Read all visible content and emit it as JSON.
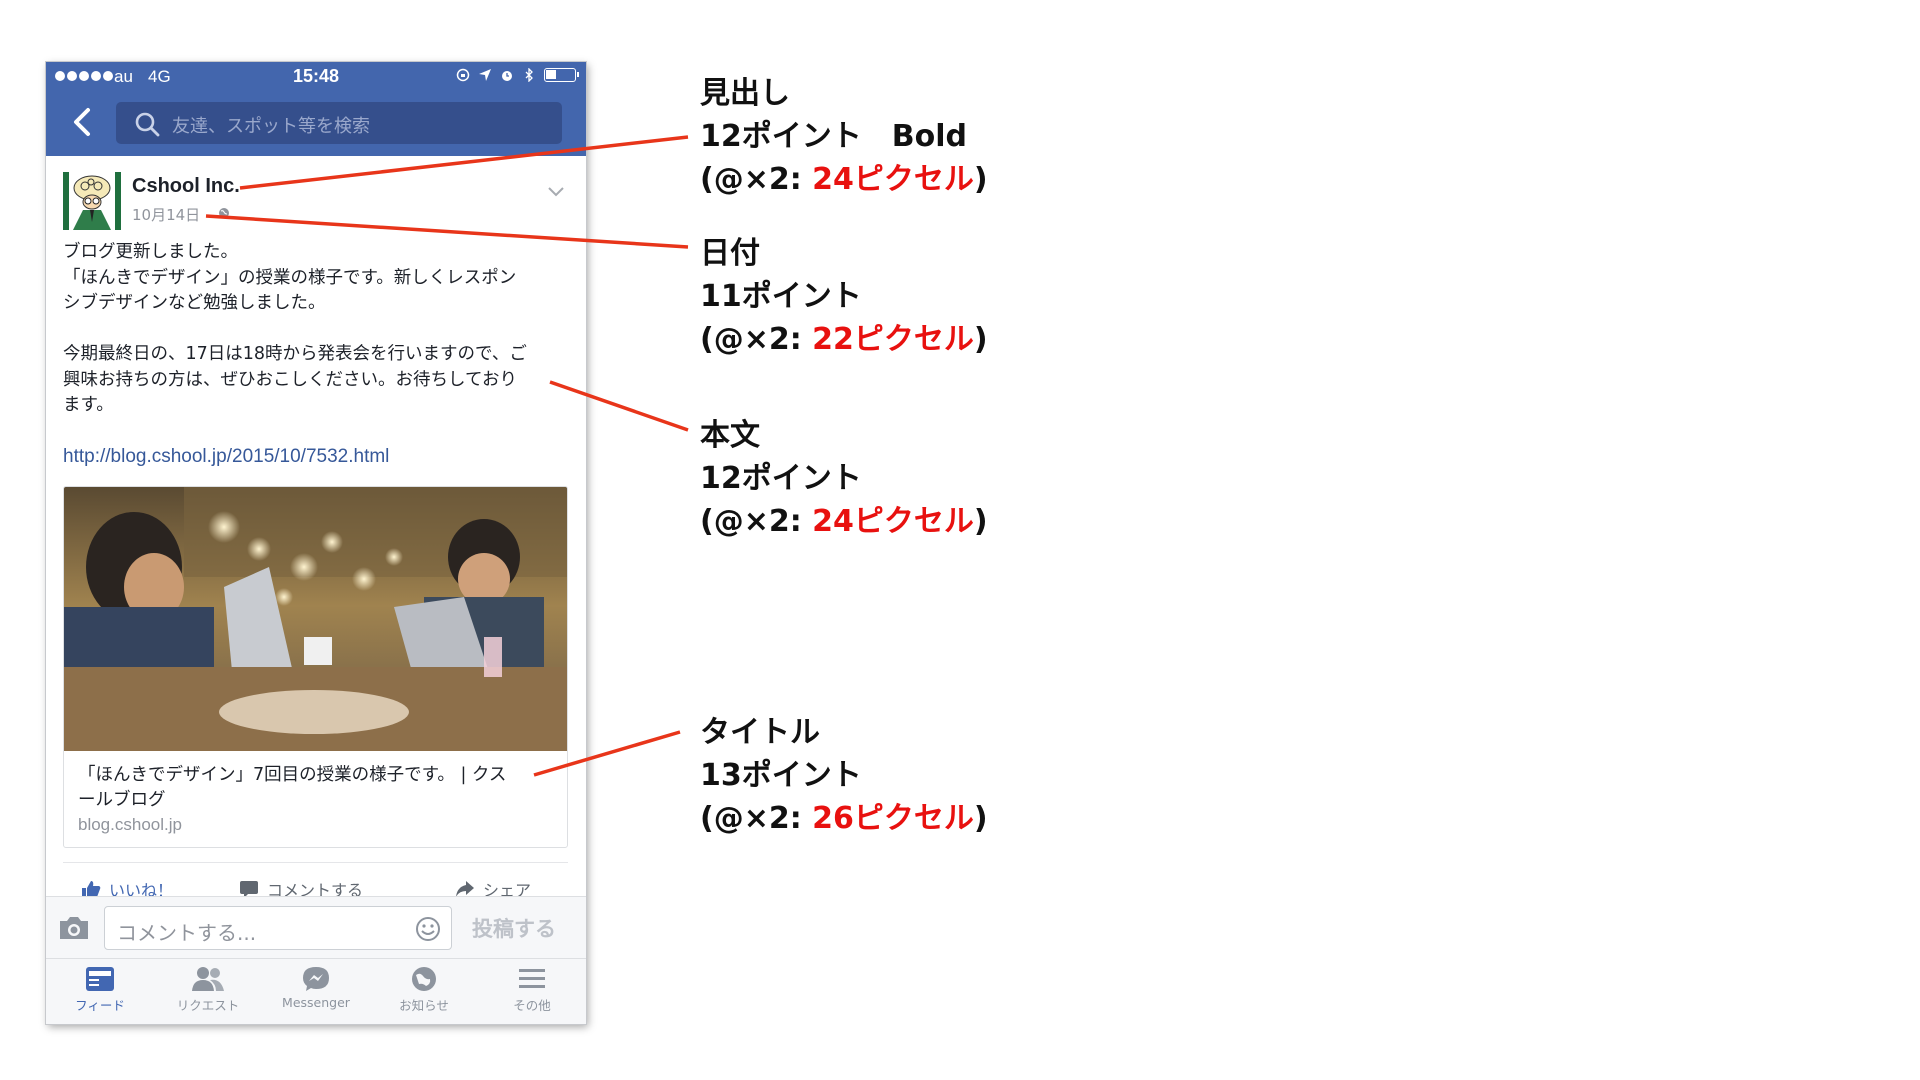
{
  "status_bar": {
    "carrier": "au",
    "network": "4G",
    "time": "15:48"
  },
  "search": {
    "placeholder": "友達、スポット等を検索"
  },
  "post": {
    "page_name": "Cshool Inc.",
    "date": "10月14日",
    "body": "ブログ更新しました。\n「ほんきでデザイン」の授業の様子です。新しくレスポン\nシブデザインなど勉強しました。\n\n今期最終日の、17日は18時から発表会を行いますので、ご\n興味お持ちの方は、ぜひおこしください。お待ちしており\nます。",
    "link_url": "http://blog.cshool.jp/2015/10/7532.html",
    "link_title": "「ほんきでデザイン」7回目の授業の様子です。 | クス\nールブログ",
    "link_domain": "blog.cshool.jp",
    "actions": {
      "like": "いいね！",
      "comment": "コメントする",
      "share": "シェア"
    }
  },
  "comment_bar": {
    "placeholder": "コメントする...",
    "post_button": "投稿する"
  },
  "tabs": [
    {
      "label": "フィード",
      "icon": "feed-icon",
      "active": true
    },
    {
      "label": "リクエスト",
      "icon": "friend-requests-icon",
      "active": false
    },
    {
      "label": "Messenger",
      "icon": "messenger-icon",
      "active": false
    },
    {
      "label": "お知らせ",
      "icon": "notifications-globe-icon",
      "active": false
    },
    {
      "label": "その他",
      "icon": "menu-icon",
      "active": false
    }
  ],
  "annotations": [
    {
      "name": "見出し",
      "points": "12ポイント　Bold",
      "prefix": "(@×2: ",
      "pixels": "24ピクセル",
      "suffix": ")"
    },
    {
      "name": "日付",
      "points": "11ポイント",
      "prefix": "(@×2: ",
      "pixels": "22ピクセル",
      "suffix": ")"
    },
    {
      "name": "本文",
      "points": "12ポイント",
      "prefix": "(@×2: ",
      "pixels": "24ピクセル",
      "suffix": ")"
    },
    {
      "name": "タイトル",
      "points": "13ポイント",
      "prefix": "(@×2: ",
      "pixels": "26ピクセル",
      "suffix": ")"
    }
  ],
  "colors": {
    "facebook_blue": "#4366ad",
    "search_box": "#354f8c",
    "link_blue": "#365899",
    "annotation_red": "#e8110f",
    "leader_line": "#e8351a"
  }
}
